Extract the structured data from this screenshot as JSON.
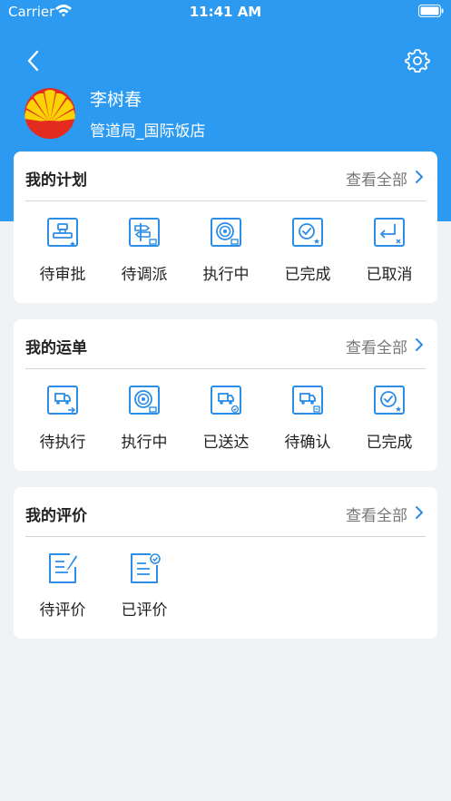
{
  "status_bar": {
    "carrier": "Carrier",
    "time": "11:41 AM"
  },
  "header": {
    "user_name": "李树春",
    "organization": "管道局_国际饭店"
  },
  "colors": {
    "primary": "#2b9af0",
    "background": "#f1f2f6",
    "icon_blue": "#2b8de6"
  },
  "plans": {
    "title": "我的计划",
    "view_all": "查看全部",
    "items": [
      {
        "label": "待审批",
        "icon": "stamp-icon"
      },
      {
        "label": "待调派",
        "icon": "signpost-icon"
      },
      {
        "label": "执行中",
        "icon": "signal-truck-icon"
      },
      {
        "label": "已完成",
        "icon": "check-star-icon"
      },
      {
        "label": "已取消",
        "icon": "return-cancel-icon"
      }
    ]
  },
  "waybills": {
    "title": "我的运单",
    "view_all": "查看全部",
    "items": [
      {
        "label": "待执行",
        "icon": "truck-arrow-icon"
      },
      {
        "label": "执行中",
        "icon": "signal-truck-icon"
      },
      {
        "label": "已送达",
        "icon": "truck-check-icon"
      },
      {
        "label": "待确认",
        "icon": "truck-pending-icon"
      },
      {
        "label": "已完成",
        "icon": "check-star-icon"
      }
    ]
  },
  "reviews": {
    "title": "我的评价",
    "view_all": "查看全部",
    "items": [
      {
        "label": "待评价",
        "icon": "edit-document-icon"
      },
      {
        "label": "已评价",
        "icon": "checked-document-icon"
      }
    ]
  }
}
